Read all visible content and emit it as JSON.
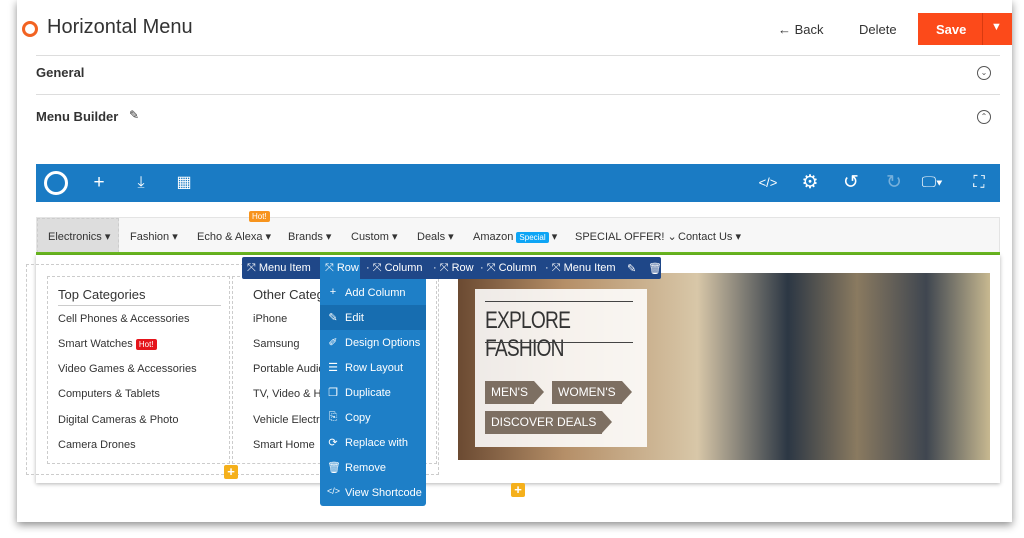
{
  "header": {
    "title": "Horizontal Menu",
    "back": "Back",
    "delete": "Delete",
    "save": "Save"
  },
  "sections": {
    "general": "General",
    "menu_builder": "Menu Builder"
  },
  "toolbar": {
    "icons": [
      "logo-icon",
      "plus-icon",
      "download-icon",
      "layout-icon",
      "code-icon",
      "gear-icon",
      "undo-icon",
      "redo-icon",
      "monitor-icon",
      "fullscreen-icon"
    ]
  },
  "menu": {
    "items": [
      "Electronics",
      "Fashion",
      "Echo & Alexa",
      "Brands",
      "Custom",
      "Deals",
      "Amazon",
      "SPECIAL OFFER!",
      "Contact Us"
    ],
    "hot_badge": "Hot!",
    "special_badge": "Special"
  },
  "breadcrumb": [
    "Menu Item",
    "Row",
    "Column",
    "Row",
    "Column",
    "Menu Item"
  ],
  "context_menu": [
    "Add Column",
    "Edit",
    "Design Options",
    "Row Layout",
    "Duplicate",
    "Copy",
    "Replace with",
    "Remove",
    "View Shortcode"
  ],
  "columns": {
    "top": {
      "heading": "Top Categories",
      "items": [
        "Cell Phones & Accessories",
        "Smart Watches",
        "Video Games & Accessories",
        "Computers & Tablets",
        "Digital Cameras & Photo",
        "Camera Drones"
      ],
      "hot_badge": "Hot!"
    },
    "other": {
      "heading": "Other Catego",
      "items": [
        "iPhone",
        "Samsung",
        "Portable Audio",
        "TV, Video & Ho",
        "Vehicle Electro",
        "Smart Home"
      ]
    }
  },
  "banner": {
    "title": "EXPLORE FASHION",
    "mens": "MEN'S",
    "womens": "WOMEN'S",
    "deals": "DISCOVER DEALS"
  },
  "colors": {
    "accent": "#1a7bc4",
    "save": "#fc4a1a",
    "green": "#6ab820",
    "crumb": "#1f4788",
    "hot": "#f7941d",
    "hot_red": "#e5141b",
    "special": "#0ea5f5"
  }
}
